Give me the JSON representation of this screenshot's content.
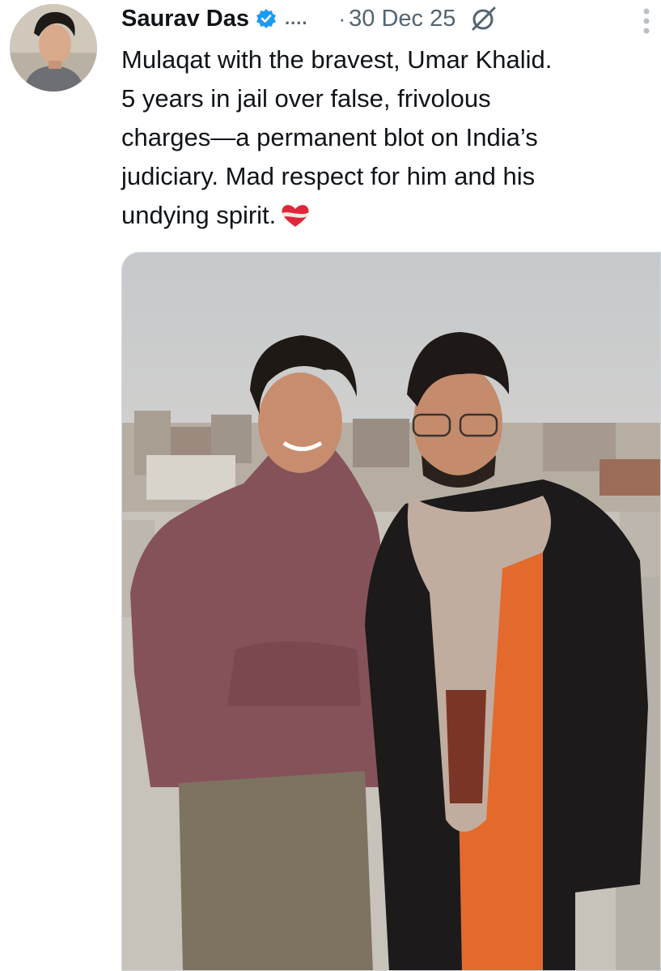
{
  "author": {
    "name": "Saurav Das",
    "verified_icon": "verified-badge-icon",
    "more_label": "...."
  },
  "meta": {
    "separator": "·",
    "timestamp": "30 Dec 25"
  },
  "icons": {
    "grok": "grok-icon",
    "more": "more-vertical-icon",
    "heart": "heart-ribbon-emoji"
  },
  "tweet": {
    "text": "Mulaqat with the bravest, Umar Khalid.\n5 years in jail over false, frivolous\ncharges—a permanent blot on India’s\njudiciary. Mad respect for him and his\nundying spirit."
  },
  "colors": {
    "verified_blue": "#1d9bf0",
    "secondary_text": "#536471",
    "heart_red": "#e0263a"
  }
}
